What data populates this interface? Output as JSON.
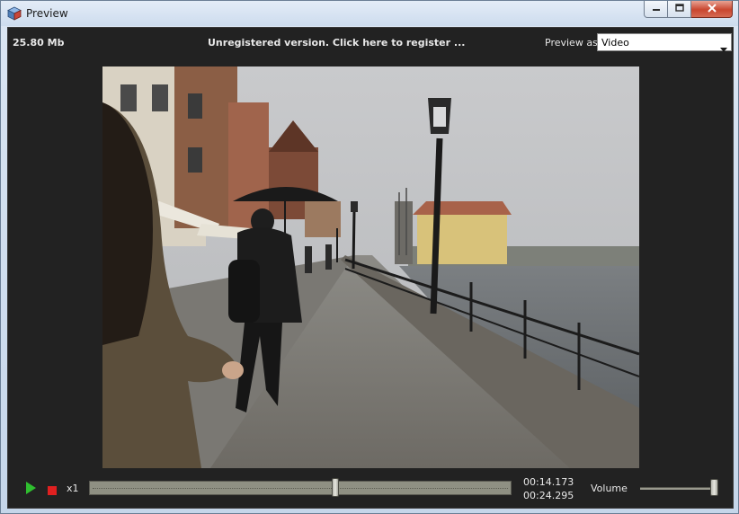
{
  "window": {
    "title": "Preview",
    "icon": "app-cube-icon",
    "controls": [
      "minimize-icon",
      "maximize-icon",
      "close-icon"
    ]
  },
  "header": {
    "file_size": "25.80 Mb",
    "register_notice": "Unregistered version. Click here to register ...",
    "preview_as_label": "Preview as",
    "preview_as_value": "Video"
  },
  "video": {
    "content": "video-frame-image"
  },
  "playback": {
    "play_icon": "play-icon",
    "stop_icon": "stop-icon",
    "speed": "x1",
    "current_time": "00:14.173",
    "total_time": "00:24.295",
    "progress_fraction": 0.5834,
    "volume_label": "Volume",
    "volume_fraction": 1.0
  },
  "colors": {
    "background": "#222222",
    "text": "#e8e8e8",
    "play_green": "#2fbf2f",
    "stop_red": "#e02020"
  }
}
